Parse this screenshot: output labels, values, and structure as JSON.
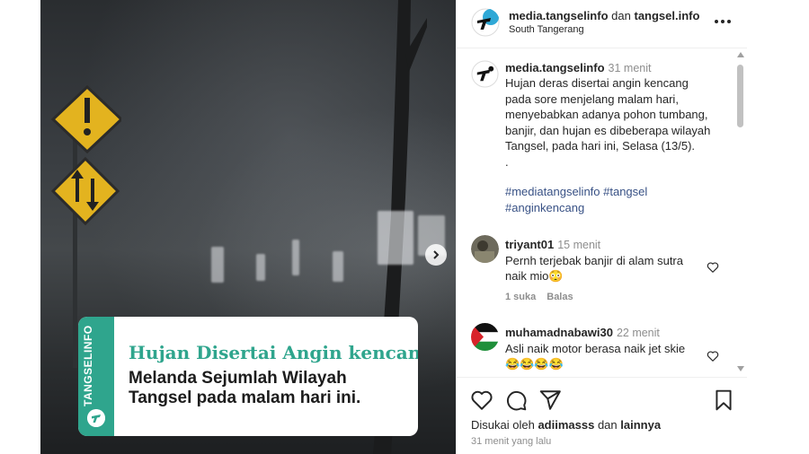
{
  "colors": {
    "accent_green": "#2fa58d",
    "link_blue": "#385185",
    "muted_gray": "#8e8e8e",
    "text_dark": "#262626"
  },
  "banner": {
    "brand": "TANGSELINFO",
    "title": "Hujan Disertai Angin kencang",
    "line1": "Melanda Sejumlah Wilayah",
    "line2": "Tangsel pada malam hari ini."
  },
  "header": {
    "account1": "media.tangselinfo",
    "connector": "dan",
    "account2": "tangsel.info",
    "location": "South Tangerang",
    "more_icon": "more-horizontal-icon"
  },
  "caption": {
    "username": "media.tangselinfo",
    "time": "31 menit",
    "lines": [
      "Hujan deras disertai angin kencang",
      "pada sore menjelang malam hari,",
      "menyebabkan adanya pohon tumbang,",
      "banjir, dan hujan es dibeberapa wilayah",
      "Tangsel, pada hari ini, Selasa (13/5).",
      "."
    ],
    "hashtags_line1": "#mediatangselinfo #tangsel",
    "hashtags_line2": "#anginkencang"
  },
  "comments": [
    {
      "username": "triyant01",
      "time": "15 menit",
      "text_line1": "Pernh terjebak banjir di alam sutra",
      "text_line2": "naik mio😳",
      "likes": "1 suka",
      "reply": "Balas"
    },
    {
      "username": "muhamadnabawi30",
      "time": "22 menit",
      "text_line1": "Asli naik motor berasa naik jet skie",
      "text_line2": "😂😂😂😂"
    }
  ],
  "actions": {
    "liked_by_prefix": "Disukai oleh",
    "liked_by_user": "adiimasss",
    "liked_by_and": "dan",
    "liked_by_others": "lainnya",
    "posted": "31 menit yang lalu"
  }
}
